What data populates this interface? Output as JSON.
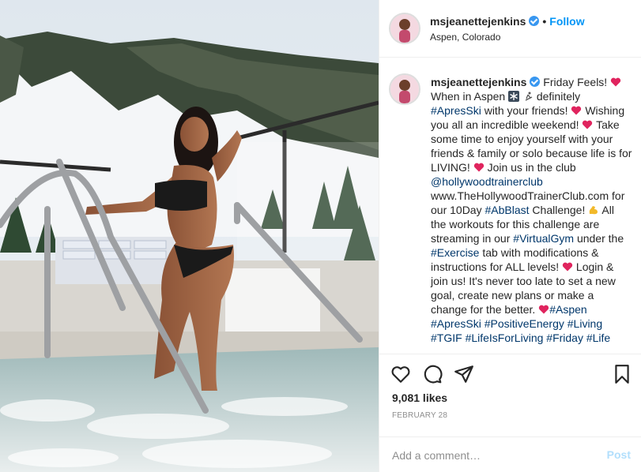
{
  "header": {
    "username": "msjeanettejenkins",
    "follow_separator": "•",
    "follow_label": "Follow",
    "location": "Aspen, Colorado",
    "verified_icon": "verified-badge-icon"
  },
  "caption": {
    "username": "msjeanettejenkins",
    "segments": {
      "s1": "Friday Feels!",
      "s2": "When in Aspen",
      "s3": "definitely",
      "tag_apresski": "#ApresSki",
      "s4": "with your friends!",
      "s5": "Wishing you all an incredible weekend!",
      "s6": "Take some time to enjoy yourself with your friends & family or solo because life is for LIVING!",
      "s7": "Join us in the club",
      "mention": "@hollywoodtrainerclub",
      "url": "www.TheHollywoodTrainerClub.com",
      "s8": "for our 10Day",
      "tag_abblast": "#AbBlast",
      "s9": "Challenge!",
      "s10": "All the workouts for this challenge are streaming in our",
      "tag_virtualgym": "#VirtualGym",
      "s11": "under the",
      "tag_exercise": "#Exercise",
      "s12": "tab with modifications & instructions for ALL levels!",
      "s13": "Login & join us! It's never too late to set a new goal, create new plans or make a change for the better.",
      "tag_aspen": "#Aspen",
      "tag_apresski2": "#ApresSki",
      "tag_positiveenergy": "#PositiveEnergy",
      "tag_living": "#Living",
      "tag_tgif": "#TGIF",
      "tag_lifeisforliving": "#LifeIsForLiving",
      "tag_friday": "#Friday",
      "tag_life": "#Life"
    },
    "emoji_icons": [
      "heart-emoji-icon",
      "snowflake-emoji-icon",
      "skier-emoji-icon",
      "flexed-biceps-emoji-icon"
    ]
  },
  "actions": {
    "icons": [
      "heart-icon",
      "comment-icon",
      "share-icon",
      "bookmark-icon"
    ],
    "likes": "9,081 likes",
    "date": "FEBRUARY 28"
  },
  "comment": {
    "placeholder": "Add a comment…",
    "post_label": "Post"
  },
  "colors": {
    "link_blue": "#0095f6",
    "hashtag": "#00376b",
    "muted": "#8e8e8e",
    "heart_red": "#e0245e"
  }
}
